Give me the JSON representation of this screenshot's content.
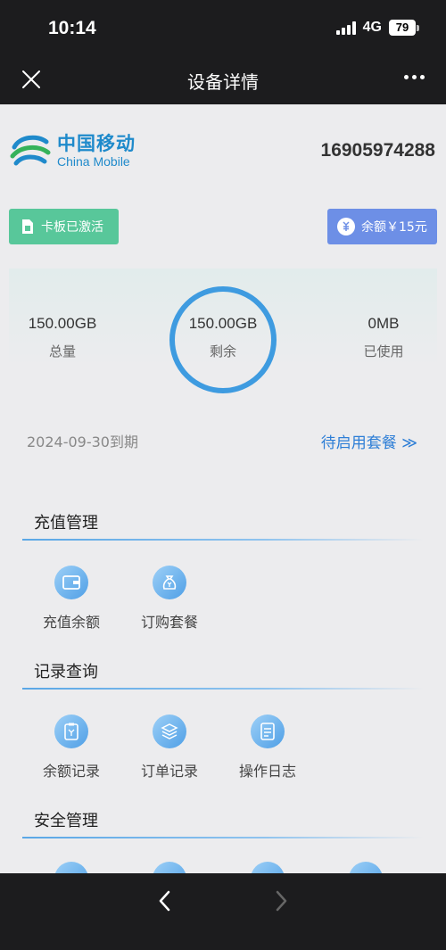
{
  "status_bar": {
    "time": "10:14",
    "network": "4G",
    "battery": "79"
  },
  "nav": {
    "title": "设备详情"
  },
  "brand": {
    "name_cn": "中国移动",
    "name_en": "China Mobile"
  },
  "phone_number": "16905974288",
  "badges": {
    "active": "卡板已激活",
    "balance": "余额￥15元"
  },
  "usage": {
    "total_value": "150.00GB",
    "total_label": "总量",
    "remaining_value": "150.00GB",
    "remaining_label": "剩余",
    "used_value": "0MB",
    "used_label": "已使用"
  },
  "expire_date": "2024-09-30到期",
  "pending_plans": "待启用套餐 ≫",
  "sections": {
    "recharge": {
      "title": "充值管理",
      "items": [
        "充值余额",
        "订购套餐"
      ]
    },
    "records": {
      "title": "记录查询",
      "items": [
        "余额记录",
        "订单记录",
        "操作日志"
      ]
    },
    "security": {
      "title": "安全管理"
    }
  },
  "colors": {
    "accent": "#3e9be0",
    "active_badge": "#58c79a",
    "balance_badge": "#6d8fe6",
    "bar": "#1c1c1e"
  }
}
